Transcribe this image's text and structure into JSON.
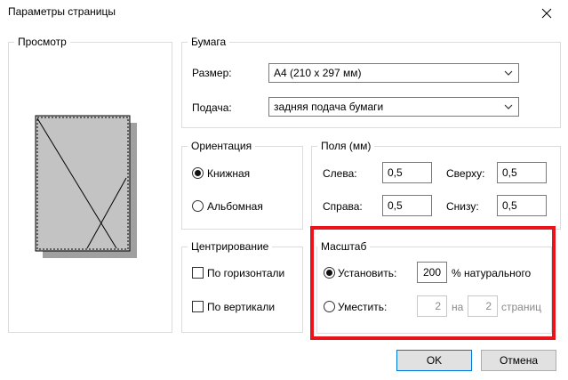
{
  "window": {
    "title": "Параметры страницы"
  },
  "preview": {
    "legend": "Просмотр"
  },
  "paper": {
    "legend": "Бумага",
    "size_label": "Размер:",
    "size_value": "A4 (210 x 297 мм)",
    "source_label": "Подача:",
    "source_value": "задняя подача бумаги"
  },
  "orientation": {
    "legend": "Ориентация",
    "portrait_label": "Книжная",
    "landscape_label": "Альбомная",
    "selected": "portrait"
  },
  "margins": {
    "legend": "Поля (мм)",
    "left_label": "Слева:",
    "left_value": "0,5",
    "top_label": "Сверху:",
    "top_value": "0,5",
    "right_label": "Справа:",
    "right_value": "0,5",
    "bottom_label": "Снизу:",
    "bottom_value": "0,5"
  },
  "centering": {
    "legend": "Центрирование",
    "horizontal_label": "По горизонтали",
    "vertical_label": "По вертикали"
  },
  "scale": {
    "legend": "Масштаб",
    "set_label": "Установить:",
    "set_value": "200",
    "set_suffix": "% натурального",
    "fit_label": "Уместить:",
    "fit_width": "2",
    "fit_mid": "на",
    "fit_height": "2",
    "fit_suffix": "страниц",
    "selected": "set",
    "highlight_color": "#e8141c"
  },
  "buttons": {
    "ok": "OK",
    "cancel": "Отмена"
  }
}
